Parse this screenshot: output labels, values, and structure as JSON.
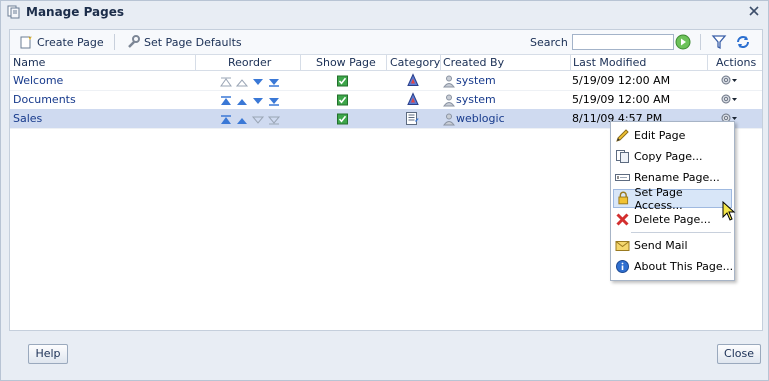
{
  "dialog": {
    "title": "Manage Pages"
  },
  "toolbar": {
    "create_label": "Create Page",
    "defaults_label": "Set Page Defaults",
    "search_label": "Search",
    "search_value": ""
  },
  "table": {
    "headers": {
      "name": "Name",
      "reorder": "Reorder",
      "show_page": "Show Page",
      "category": "Category",
      "created_by": "Created By",
      "last_modified": "Last Modified",
      "actions": "Actions"
    },
    "rows": [
      {
        "name": "Welcome",
        "created_by": "system",
        "last_modified": "5/19/09 12:00 AM"
      },
      {
        "name": "Documents",
        "created_by": "system",
        "last_modified": "5/19/09 12:00 AM"
      },
      {
        "name": "Sales",
        "created_by": "weblogic",
        "last_modified": "8/11/09 4:57 PM"
      }
    ]
  },
  "context_menu": {
    "items": [
      {
        "label": "Edit Page"
      },
      {
        "label": "Copy Page..."
      },
      {
        "label": "Rename Page..."
      },
      {
        "label": "Set Page Access..."
      },
      {
        "label": "Delete Page..."
      },
      {
        "label": "Send Mail"
      },
      {
        "label": "About This Page..."
      }
    ]
  },
  "footer": {
    "help_label": "Help",
    "close_label": "Close"
  }
}
